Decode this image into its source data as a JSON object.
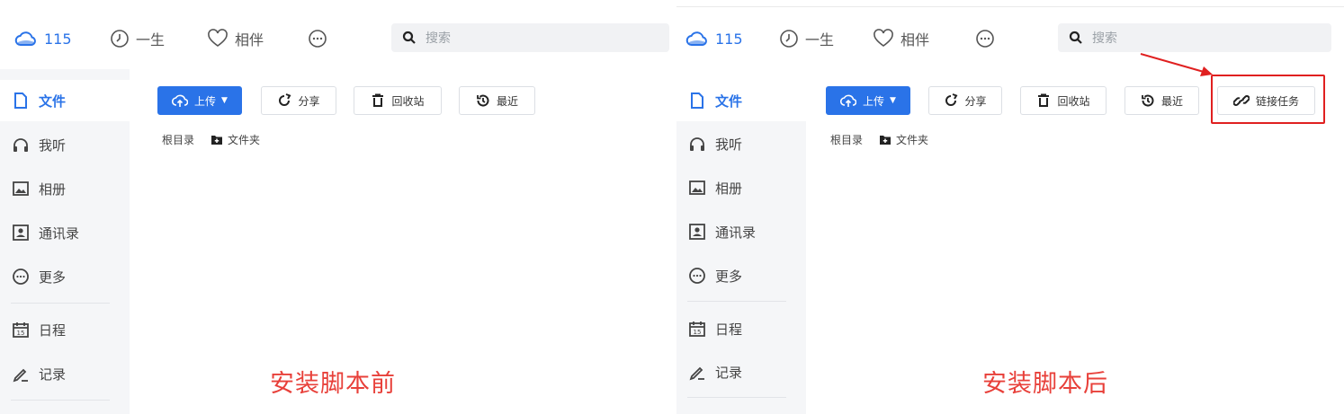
{
  "before": {
    "topnav": {
      "cloud_label": "115",
      "life_label": "一生",
      "partner_label": "相伴",
      "search_placeholder": "搜索"
    },
    "sidebar": {
      "items": [
        {
          "label": "文件",
          "icon": "file-icon",
          "active": true
        },
        {
          "label": "我听",
          "icon": "headphones-icon"
        },
        {
          "label": "相册",
          "icon": "image-icon"
        },
        {
          "label": "通讯录",
          "icon": "contact-icon"
        },
        {
          "label": "更多",
          "icon": "more-icon"
        },
        {
          "label": "日程",
          "icon": "calendar-icon"
        },
        {
          "label": "记录",
          "icon": "pen-icon"
        }
      ]
    },
    "toolbar": {
      "upload_label": "上传",
      "share_label": "分享",
      "recycle_label": "回收站",
      "recent_label": "最近"
    },
    "breadcrumb": {
      "root_label": "根目录",
      "folder_label": "文件夹"
    },
    "caption": "安装脚本前"
  },
  "after": {
    "topnav": {
      "cloud_label": "115",
      "life_label": "一生",
      "partner_label": "相伴",
      "search_placeholder": "搜索"
    },
    "sidebar": {
      "items": [
        {
          "label": "文件",
          "icon": "file-icon",
          "active": true
        },
        {
          "label": "我听",
          "icon": "headphones-icon"
        },
        {
          "label": "相册",
          "icon": "image-icon"
        },
        {
          "label": "通讯录",
          "icon": "contact-icon"
        },
        {
          "label": "更多",
          "icon": "more-icon"
        },
        {
          "label": "日程",
          "icon": "calendar-icon"
        },
        {
          "label": "记录",
          "icon": "pen-icon"
        }
      ]
    },
    "toolbar": {
      "upload_label": "上传",
      "share_label": "分享",
      "recycle_label": "回收站",
      "recent_label": "最近",
      "link_task_label": "链接任务"
    },
    "breadcrumb": {
      "root_label": "根目录",
      "folder_label": "文件夹"
    },
    "caption": "安装脚本后"
  },
  "colors": {
    "accent": "#2a73e8",
    "caption": "#e8403a",
    "highlight": "#e02020",
    "sidebar_bg": "#f5f6f8"
  }
}
